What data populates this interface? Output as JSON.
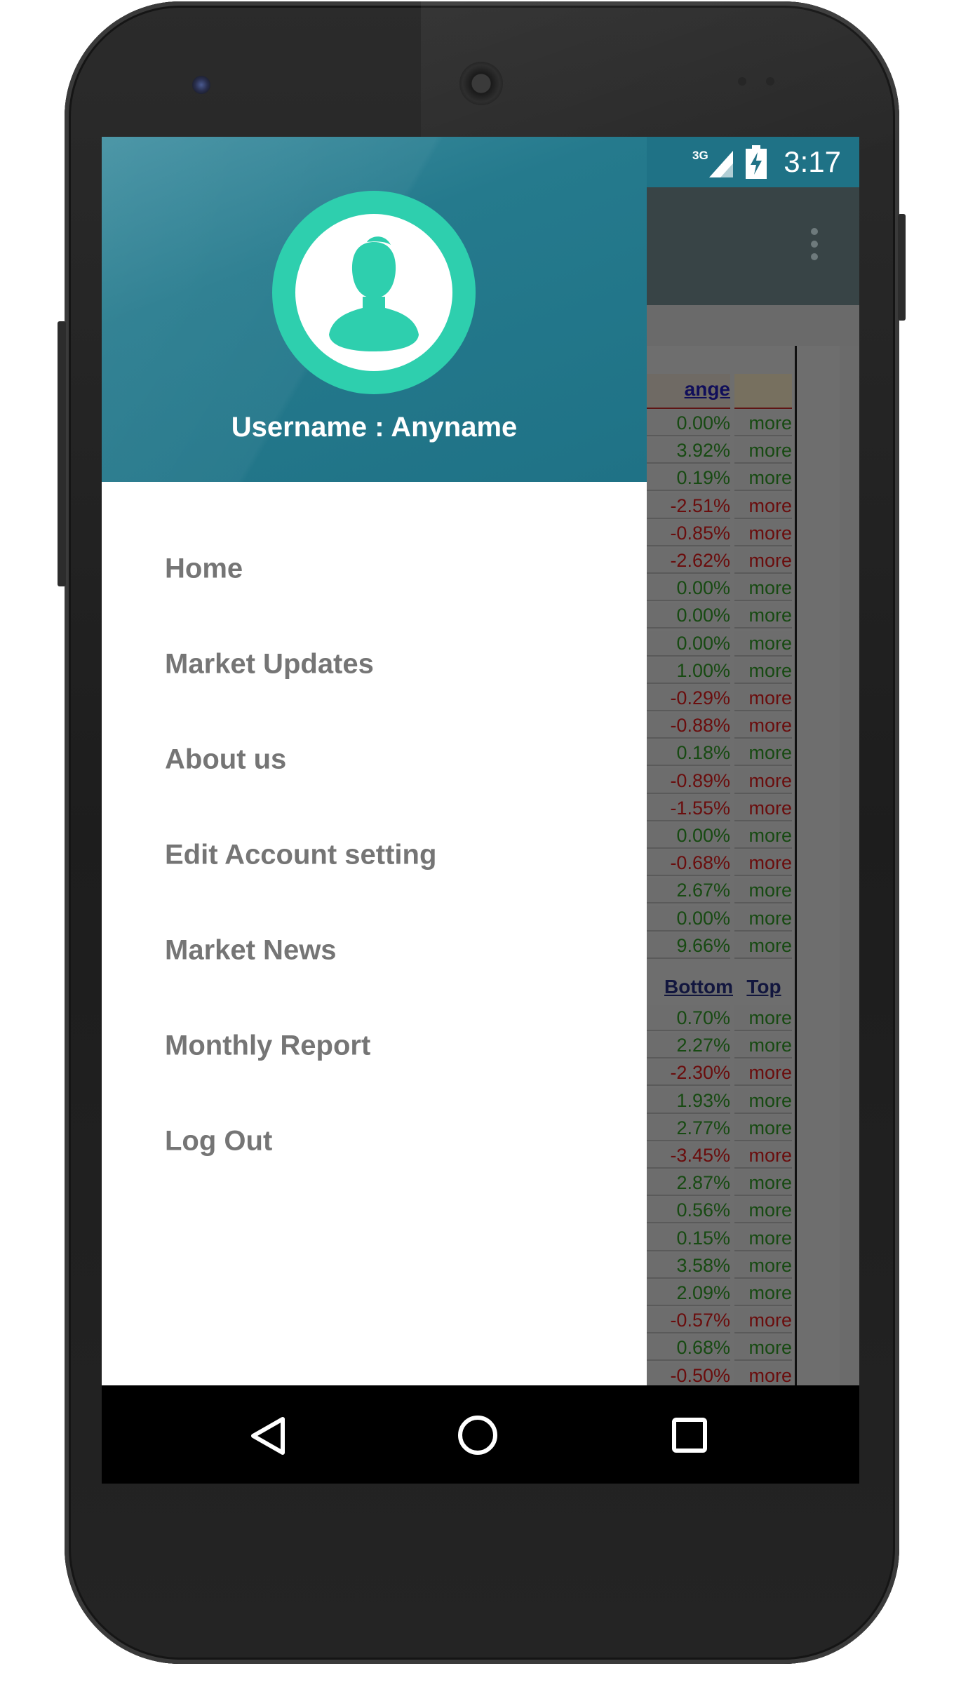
{
  "status_bar": {
    "network": "3G",
    "time": "3:17",
    "icons": [
      "signal-icon",
      "battery-charging-icon"
    ]
  },
  "drawer": {
    "avatar_icon": "user-avatar-icon",
    "username": "Username : Anyname",
    "menu": [
      {
        "label": "Home"
      },
      {
        "label": "Market Updates"
      },
      {
        "label": "About us"
      },
      {
        "label": "Edit Account setting"
      },
      {
        "label": "Market News"
      },
      {
        "label": "Monthly Report"
      },
      {
        "label": "Log Out"
      }
    ]
  },
  "background_table": {
    "header_change": "ange",
    "header_bottom": "Bottom",
    "header_top": "Top",
    "more_label": "more",
    "rows_top": [
      {
        "pct": "0.00%",
        "dir": "up"
      },
      {
        "pct": "3.92%",
        "dir": "up"
      },
      {
        "pct": "0.19%",
        "dir": "up"
      },
      {
        "pct": "-2.51%",
        "dir": "down"
      },
      {
        "pct": "-0.85%",
        "dir": "down"
      },
      {
        "pct": "-2.62%",
        "dir": "down"
      },
      {
        "pct": "0.00%",
        "dir": "up"
      },
      {
        "pct": "0.00%",
        "dir": "up"
      },
      {
        "pct": "0.00%",
        "dir": "up"
      },
      {
        "pct": "1.00%",
        "dir": "up"
      },
      {
        "pct": "-0.29%",
        "dir": "down"
      },
      {
        "pct": "-0.88%",
        "dir": "down"
      },
      {
        "pct": "0.18%",
        "dir": "up"
      },
      {
        "pct": "-0.89%",
        "dir": "down"
      },
      {
        "pct": "-1.55%",
        "dir": "down"
      },
      {
        "pct": "0.00%",
        "dir": "up"
      },
      {
        "pct": "-0.68%",
        "dir": "down"
      },
      {
        "pct": "2.67%",
        "dir": "up"
      },
      {
        "pct": "0.00%",
        "dir": "up"
      },
      {
        "pct": "9.66%",
        "dir": "up"
      }
    ],
    "rows_bottom": [
      {
        "pct": "0.70%",
        "dir": "up"
      },
      {
        "pct": "2.27%",
        "dir": "up"
      },
      {
        "pct": "-2.30%",
        "dir": "down"
      },
      {
        "pct": "1.93%",
        "dir": "up"
      },
      {
        "pct": "2.77%",
        "dir": "up"
      },
      {
        "pct": "-3.45%",
        "dir": "down"
      },
      {
        "pct": "2.87%",
        "dir": "up"
      },
      {
        "pct": "0.56%",
        "dir": "up"
      },
      {
        "pct": "0.15%",
        "dir": "up"
      },
      {
        "pct": "3.58%",
        "dir": "up"
      },
      {
        "pct": "2.09%",
        "dir": "up"
      },
      {
        "pct": "-0.57%",
        "dir": "down"
      },
      {
        "pct": "0.68%",
        "dir": "up"
      },
      {
        "pct": "-0.50%",
        "dir": "down"
      }
    ]
  },
  "toolbar": {
    "overflow_icon": "more-vertical-icon"
  },
  "nav_bar": {
    "icons": [
      "back-icon",
      "home-icon",
      "recents-icon"
    ]
  },
  "colors": {
    "header_teal": "#1f7286",
    "avatar_mint": "#2ecfae",
    "menu_text": "#757575",
    "positive_text": "#174a12",
    "negative_text": "#6a0d0d"
  }
}
